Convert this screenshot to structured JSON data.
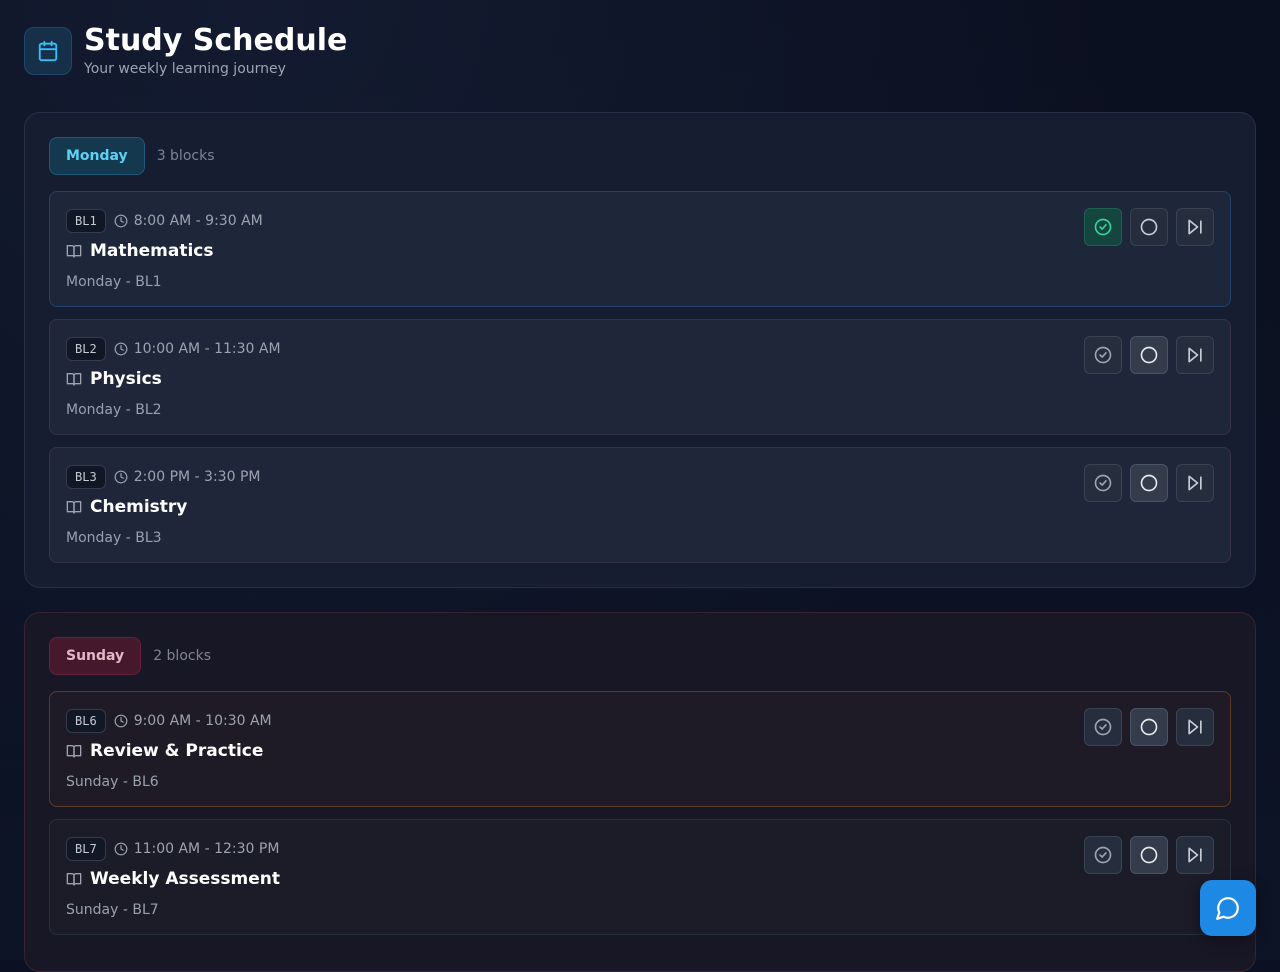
{
  "header": {
    "title": "Study Schedule",
    "subtitle": "Your weekly learning journey",
    "icon": "calendar-icon"
  },
  "colors": {
    "accent": "#5ed0f3",
    "sunday_accent": "#e2b8c6",
    "done": "#14463f",
    "fab": "#1e88e5"
  },
  "days": [
    {
      "label": "Monday",
      "count": "3 blocks",
      "blocks": [
        {
          "code": "BL1",
          "time": "8:00 AM - 9:30 AM",
          "subject": "Mathematics",
          "sub": "Monday - BL1",
          "status": "done"
        },
        {
          "code": "BL2",
          "time": "10:00 AM - 11:30 AM",
          "subject": "Physics",
          "sub": "Monday - BL2",
          "status": "pending"
        },
        {
          "code": "BL3",
          "time": "2:00 PM - 3:30 PM",
          "subject": "Chemistry",
          "sub": "Monday - BL3",
          "status": "pending"
        }
      ]
    },
    {
      "label": "Sunday",
      "count": "2 blocks",
      "blocks": [
        {
          "code": "BL6",
          "time": "9:00 AM - 10:30 AM",
          "subject": "Review & Practice",
          "sub": "Sunday - BL6",
          "status": "pending"
        },
        {
          "code": "BL7",
          "time": "11:00 AM - 12:30 PM",
          "subject": "Weekly Assessment",
          "sub": "Sunday - BL7",
          "status": "pending"
        }
      ]
    }
  ],
  "actions": {
    "complete_icon": "check-circle-icon",
    "pending_icon": "circle-icon",
    "skip_icon": "skip-forward-icon"
  },
  "chat": {
    "icon": "chat-icon"
  }
}
